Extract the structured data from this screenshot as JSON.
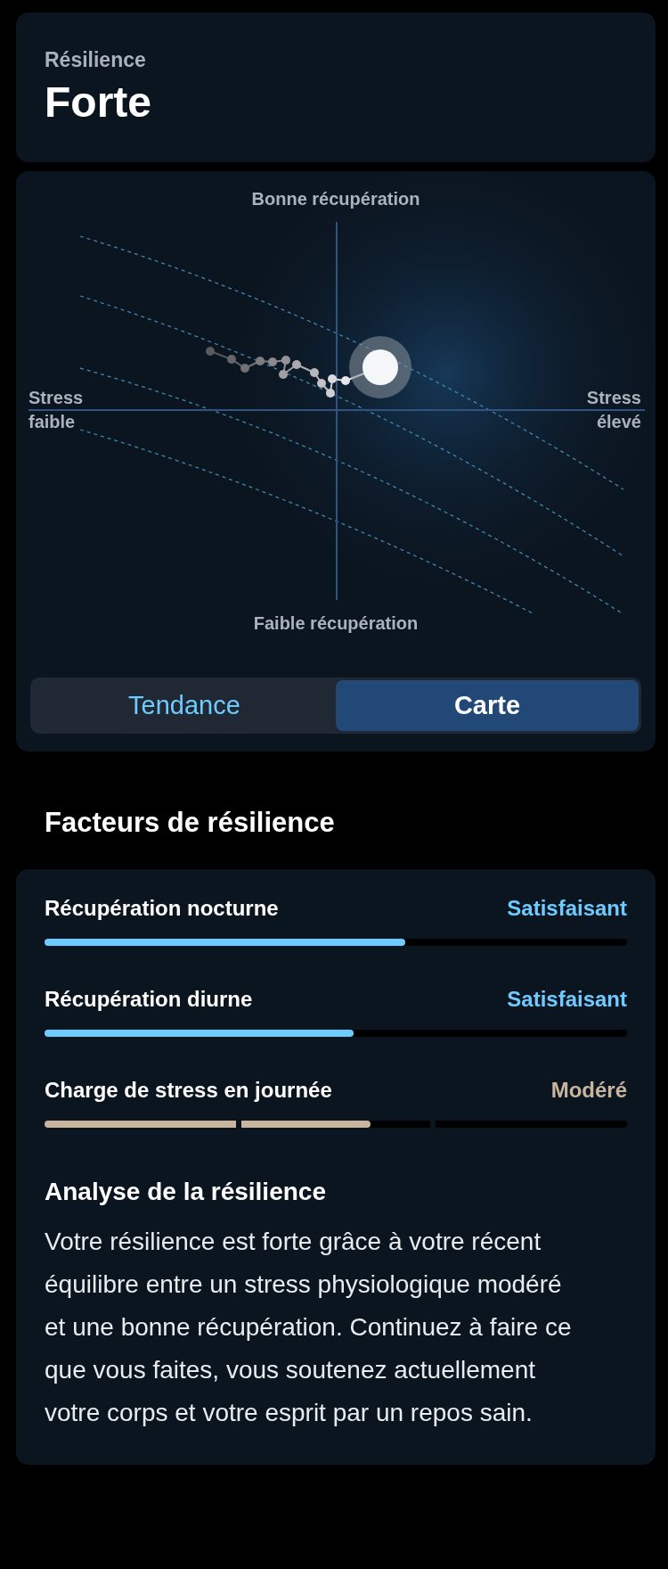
{
  "header": {
    "label": "Résilience",
    "value": "Forte"
  },
  "map": {
    "top_label": "Bonne récupération",
    "bottom_label": "Faible récupération",
    "left_label": "Stress faible",
    "right_label": "Stress élevé"
  },
  "view_tabs": [
    {
      "label": "Tendance",
      "selected": false
    },
    {
      "label": "Carte",
      "selected": true
    }
  ],
  "factors_title": "Facteurs de résilience",
  "factors": [
    {
      "kind": "bar",
      "name": "Récupération nocturne",
      "rating": "Satisfaisant",
      "color": "#6ecbff",
      "level": 0.62
    },
    {
      "kind": "bar",
      "name": "Récupération diurne",
      "rating": "Satisfaisant",
      "color": "#6ecbff",
      "level": 0.53
    },
    {
      "kind": "segmented",
      "name": "Charge de stress en journée",
      "rating": "Modéré",
      "color": "#c9b49e",
      "level": 0.56
    }
  ],
  "analysis": {
    "title": "Analyse de la résilience",
    "text": "Votre résilience est forte grâce à votre récent équilibre entre un stress physiologique modéré et une bonne récupération. Continuez à faire ce que vous faites, vous soutenez actuellement votre corps et votre esprit par un repos sain."
  }
}
